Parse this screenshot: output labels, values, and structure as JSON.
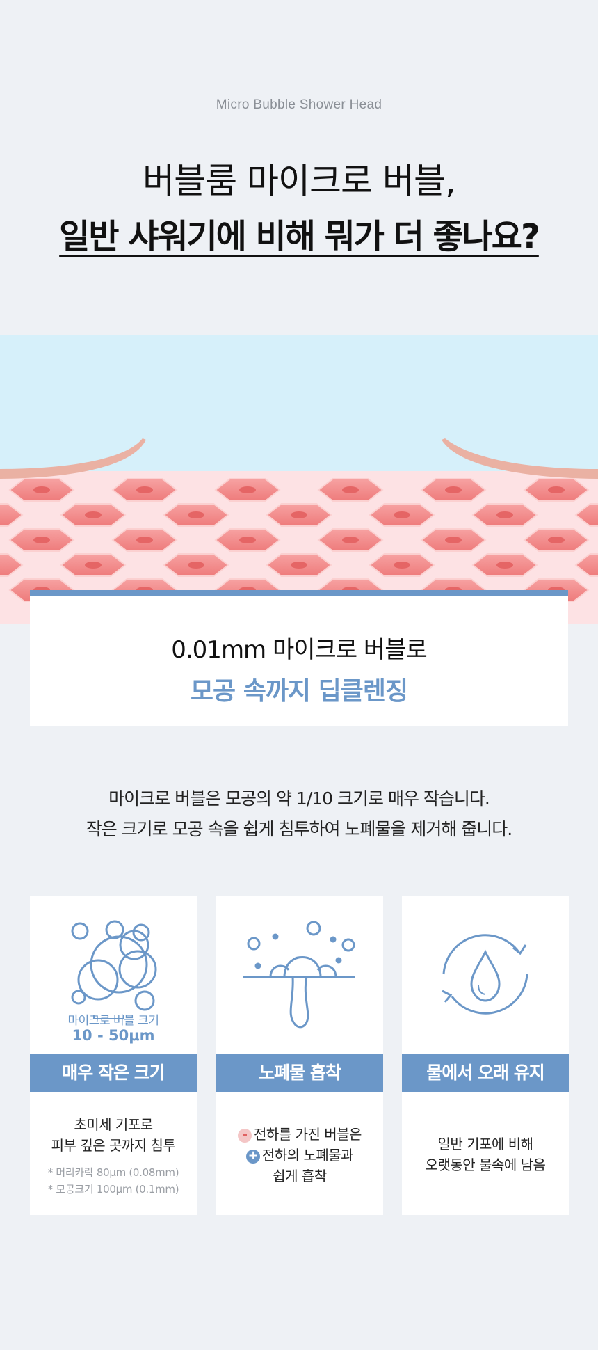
{
  "header": {
    "eyebrow": "Micro Bubble Shower Head",
    "headline_line1": "버블룸 마이크로 버블,",
    "headline_line2": "일반 샤워기에 비해 뭐가 더 좋나요?"
  },
  "highlight_card": {
    "line1": "0.01mm 마이크로 버블로",
    "line2": "모공 속까지 딥클렌징"
  },
  "description": {
    "line1": "마이크로 버블은 모공의 약 1/10 크기로 매우 작습니다.",
    "line2": "작은 크기로 모공 속을 쉽게 침투하여 노폐물을 제거해 줍니다."
  },
  "features": [
    {
      "icon": "bubbles-icon",
      "icon_caption": "마이크로 버블 크기",
      "icon_value": "10 - 50μm",
      "title": "매우 작은 크기",
      "text_line1": "초미세 기포로",
      "text_line2": "피부 깊은 곳까지 침투",
      "note_line1": "* 머리카락 80μm (0.08mm)",
      "note_line2": "* 모공크기 100μm (0.1mm)"
    },
    {
      "icon": "pore-absorb-icon",
      "title": "노폐물 흡착",
      "text_line1": "전하를 가진 버블은",
      "text_line2": "전하의 노폐물과",
      "text_line3": "쉽게 흡착",
      "minus_symbol": "-",
      "plus_symbol": "+"
    },
    {
      "icon": "water-cycle-icon",
      "title": "물에서 오래 유지",
      "text_line1": "일반 기포에 비해",
      "text_line2": "오랫동안 물속에 남음"
    }
  ],
  "colors": {
    "accent": "#6b97c8",
    "background": "#eef1f5",
    "water": "#d6f0fa",
    "skin_cell": "#f28a8a"
  }
}
